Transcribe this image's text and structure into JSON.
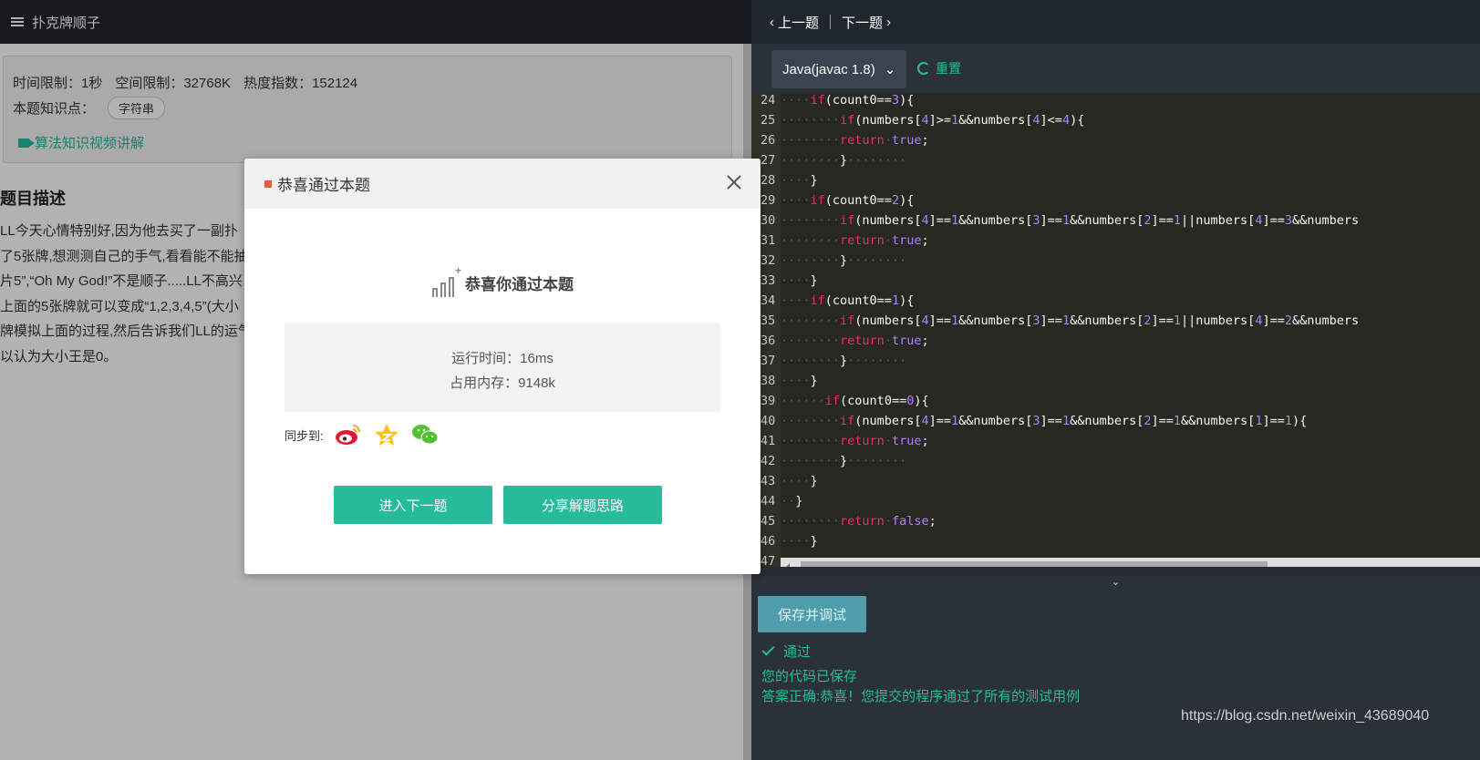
{
  "header": {
    "problem_title": "扑克牌顺子",
    "prev_label": "上一题",
    "next_label": "下一题"
  },
  "problem_info": {
    "time_limit": "时间限制：1秒",
    "space_limit": "空间限制：32768K",
    "heat": "热度指数：152124",
    "knowledge_label": "本题知识点：",
    "knowledge_tag": "字符串",
    "video_link": "算法知识视频讲解"
  },
  "description": {
    "title": "题目描述",
    "lines": [
      "LL今天心情特别好,因为他去买了一副扑",
      "了5张牌,想测测自己的手气,看看能不能抽",
      "片5”,“Oh My God!”不是顺子.....LL不高兴",
      "上面的5张牌就可以变成“1,2,3,4,5”(大小",
      "牌模拟上面的过程,然后告诉我们LL的运气",
      "以认为大小王是0。"
    ]
  },
  "editor": {
    "language": "Java(javac 1.8)",
    "reset_label": "重置",
    "lines": [
      {
        "n": "24",
        "indent": "····",
        "tokens": [
          [
            "kw",
            "if"
          ],
          [
            "t",
            "(count0=="
          ],
          [
            "num",
            "3"
          ],
          [
            "t",
            "){"
          ]
        ]
      },
      {
        "n": "25",
        "indent": "········",
        "tokens": [
          [
            "kw",
            "if"
          ],
          [
            "t",
            "(numbers["
          ],
          [
            "num",
            "4"
          ],
          [
            "t",
            "]>="
          ],
          [
            "num",
            "1"
          ],
          [
            "t",
            "&&numbers["
          ],
          [
            "num",
            "4"
          ],
          [
            "t",
            "]<="
          ],
          [
            "num",
            "4"
          ],
          [
            "t",
            "){"
          ]
        ]
      },
      {
        "n": "26",
        "indent": "········",
        "tokens": [
          [
            "kw",
            "return"
          ],
          [
            "ws",
            "·"
          ],
          [
            "lit",
            "true"
          ],
          [
            "t",
            ";"
          ]
        ]
      },
      {
        "n": "27",
        "indent": "········",
        "tokens": [
          [
            "t",
            "}"
          ],
          [
            "ws",
            "········"
          ]
        ]
      },
      {
        "n": "28",
        "indent": "····",
        "tokens": [
          [
            "t",
            "}"
          ]
        ]
      },
      {
        "n": "29",
        "indent": "····",
        "tokens": [
          [
            "kw",
            "if"
          ],
          [
            "t",
            "(count0=="
          ],
          [
            "num",
            "2"
          ],
          [
            "t",
            "){"
          ]
        ]
      },
      {
        "n": "30",
        "indent": "········",
        "tokens": [
          [
            "kw",
            "if"
          ],
          [
            "t",
            "(numbers["
          ],
          [
            "num",
            "4"
          ],
          [
            "t",
            "]=="
          ],
          [
            "num",
            "1"
          ],
          [
            "t",
            "&&numbers["
          ],
          [
            "num",
            "3"
          ],
          [
            "t",
            "]=="
          ],
          [
            "num",
            "1"
          ],
          [
            "t",
            "&&numbers["
          ],
          [
            "num",
            "2"
          ],
          [
            "t",
            "]=="
          ],
          [
            "num",
            "1"
          ],
          [
            "t",
            "||numbers["
          ],
          [
            "num",
            "4"
          ],
          [
            "t",
            "]=="
          ],
          [
            "num",
            "3"
          ],
          [
            "t",
            "&&numbers"
          ]
        ]
      },
      {
        "n": "31",
        "indent": "········",
        "tokens": [
          [
            "kw",
            "return"
          ],
          [
            "ws",
            "·"
          ],
          [
            "lit",
            "true"
          ],
          [
            "t",
            ";"
          ]
        ]
      },
      {
        "n": "32",
        "indent": "········",
        "tokens": [
          [
            "t",
            "}"
          ],
          [
            "ws",
            "········"
          ]
        ]
      },
      {
        "n": "33",
        "indent": "····",
        "tokens": [
          [
            "t",
            "}"
          ]
        ]
      },
      {
        "n": "34",
        "indent": "····",
        "tokens": [
          [
            "kw",
            "if"
          ],
          [
            "t",
            "(count0=="
          ],
          [
            "num",
            "1"
          ],
          [
            "t",
            "){"
          ]
        ]
      },
      {
        "n": "35",
        "indent": "········",
        "tokens": [
          [
            "kw",
            "if"
          ],
          [
            "t",
            "(numbers["
          ],
          [
            "num",
            "4"
          ],
          [
            "t",
            "]=="
          ],
          [
            "num",
            "1"
          ],
          [
            "t",
            "&&numbers["
          ],
          [
            "num",
            "3"
          ],
          [
            "t",
            "]=="
          ],
          [
            "num",
            "1"
          ],
          [
            "t",
            "&&numbers["
          ],
          [
            "num",
            "2"
          ],
          [
            "t",
            "]=="
          ],
          [
            "num",
            "1"
          ],
          [
            "t",
            "||numbers["
          ],
          [
            "num",
            "4"
          ],
          [
            "t",
            "]=="
          ],
          [
            "num",
            "2"
          ],
          [
            "t",
            "&&numbers"
          ]
        ]
      },
      {
        "n": "36",
        "indent": "········",
        "tokens": [
          [
            "kw",
            "return"
          ],
          [
            "ws",
            "·"
          ],
          [
            "lit",
            "true"
          ],
          [
            "t",
            ";"
          ]
        ]
      },
      {
        "n": "37",
        "indent": "········",
        "tokens": [
          [
            "t",
            "}"
          ],
          [
            "ws",
            "········"
          ]
        ]
      },
      {
        "n": "38",
        "indent": "····",
        "tokens": [
          [
            "t",
            "}"
          ]
        ]
      },
      {
        "n": "39",
        "indent": "······",
        "tokens": [
          [
            "kw",
            "if"
          ],
          [
            "t",
            "(count0=="
          ],
          [
            "num",
            "0"
          ],
          [
            "t",
            "){"
          ]
        ]
      },
      {
        "n": "40",
        "indent": "········",
        "tokens": [
          [
            "kw",
            "if"
          ],
          [
            "t",
            "(numbers["
          ],
          [
            "num",
            "4"
          ],
          [
            "t",
            "]=="
          ],
          [
            "num",
            "1"
          ],
          [
            "t",
            "&&numbers["
          ],
          [
            "num",
            "3"
          ],
          [
            "t",
            "]=="
          ],
          [
            "num",
            "1"
          ],
          [
            "t",
            "&&numbers["
          ],
          [
            "num",
            "2"
          ],
          [
            "t",
            "]=="
          ],
          [
            "num",
            "1"
          ],
          [
            "t",
            "&&numbers["
          ],
          [
            "num",
            "1"
          ],
          [
            "t",
            "]=="
          ],
          [
            "num",
            "1"
          ],
          [
            "t",
            "){"
          ]
        ]
      },
      {
        "n": "41",
        "indent": "········",
        "tokens": [
          [
            "kw",
            "return"
          ],
          [
            "ws",
            "·"
          ],
          [
            "lit",
            "true"
          ],
          [
            "t",
            ";"
          ]
        ]
      },
      {
        "n": "42",
        "indent": "········",
        "tokens": [
          [
            "t",
            "}"
          ],
          [
            "ws",
            "········"
          ]
        ]
      },
      {
        "n": "43",
        "indent": "····",
        "tokens": [
          [
            "t",
            "}"
          ]
        ]
      },
      {
        "n": "44",
        "indent": "··",
        "tokens": [
          [
            "t",
            "}"
          ]
        ]
      },
      {
        "n": "45",
        "indent": "········",
        "tokens": [
          [
            "kw",
            "return"
          ],
          [
            "ws",
            "·"
          ],
          [
            "lit",
            "false"
          ],
          [
            "t",
            ";"
          ]
        ]
      },
      {
        "n": "46",
        "indent": "····",
        "tokens": [
          [
            "t",
            "}"
          ]
        ]
      },
      {
        "n": "47",
        "indent": "",
        "tokens": []
      }
    ]
  },
  "bottom": {
    "save_debug": "保存并调试",
    "pass_label": "通过",
    "saved_msg": "您的代码已保存",
    "correct_msg": "答案正确:恭喜！您提交的程序通过了所有的测试用例"
  },
  "modal": {
    "title": "恭喜通过本题",
    "congrats": "恭喜你通过本题",
    "run_time": "运行时间：16ms",
    "memory": "占用内存：9148k",
    "sync_label": "同步到:",
    "share_icons": [
      "weibo-icon",
      "qzone-icon",
      "wechat-icon"
    ],
    "next_button": "进入下一题",
    "share_button": "分享解题思路"
  },
  "watermark": "https://blog.csdn.net/weixin_43689040",
  "colors": {
    "accent": "#25bb9b",
    "topbar": "#20262d",
    "editor_bg": "#272822",
    "keyword": "#f92672",
    "number": "#ae81ff"
  }
}
